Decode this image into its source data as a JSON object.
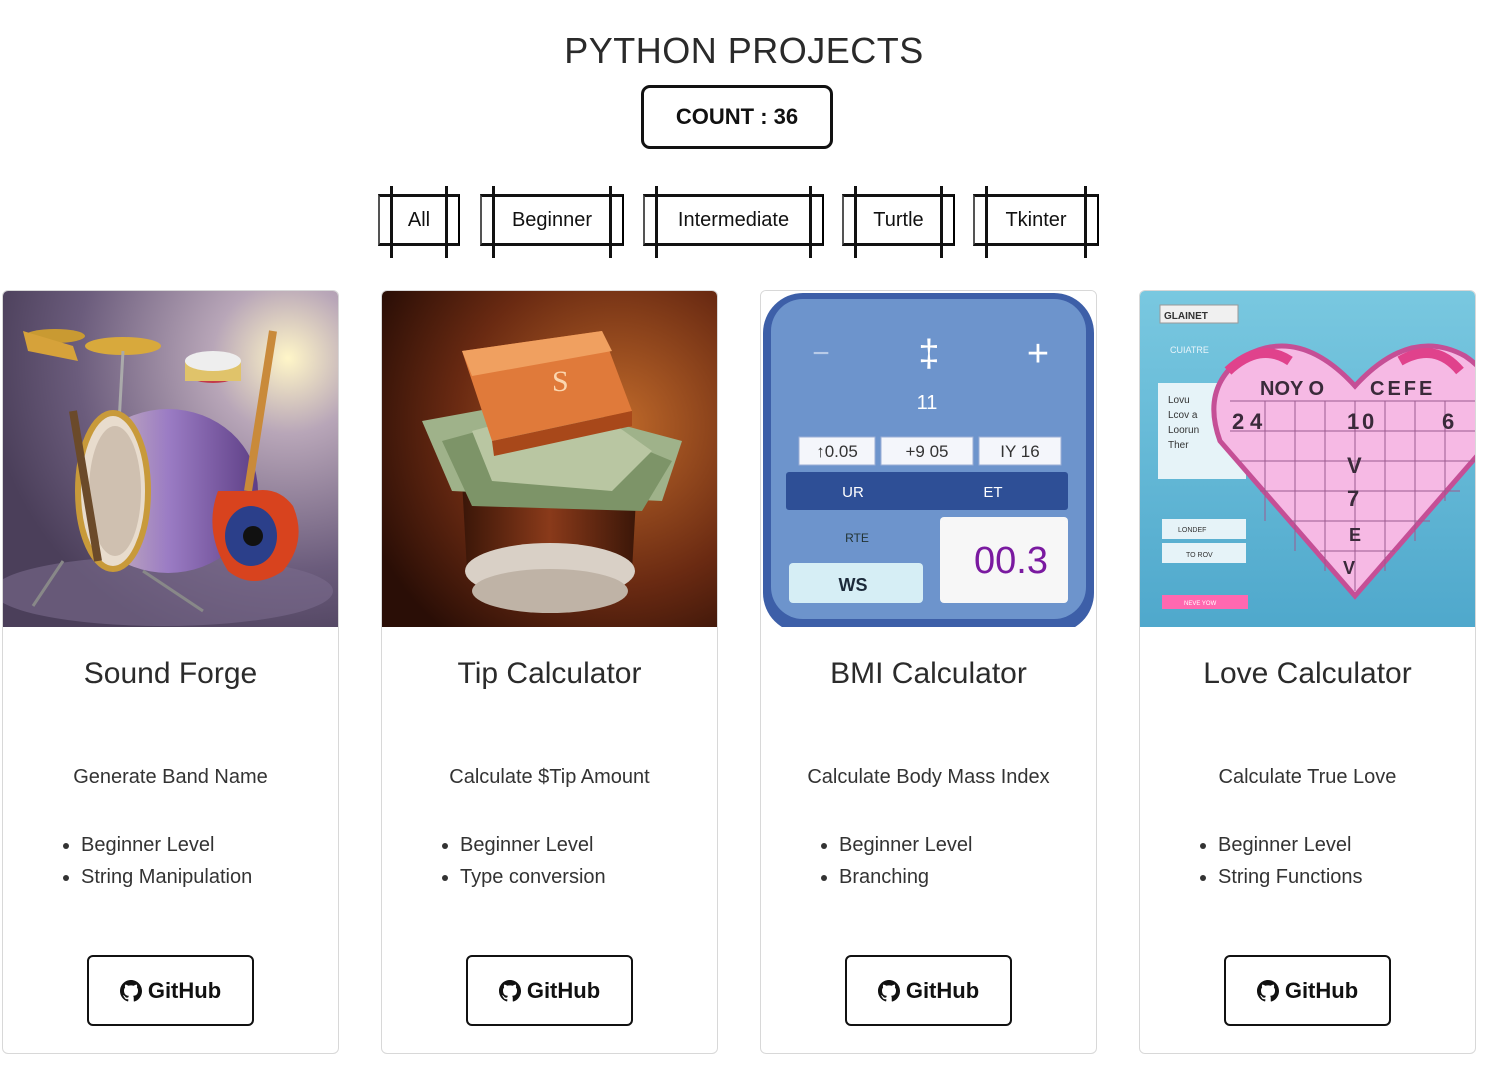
{
  "header": {
    "title": "PYTHON PROJECTS",
    "count": "COUNT : 36"
  },
  "filters": [
    "All",
    "Beginner",
    "Intermediate",
    "Turtle",
    "Tkinter"
  ],
  "cards": [
    {
      "title": "Sound Forge",
      "description": "Generate Band Name",
      "tags": [
        "Beginner Level",
        "String Manipulation"
      ],
      "button": "GitHub"
    },
    {
      "title": "Tip Calculator",
      "description": "Calculate $Tip Amount",
      "tags": [
        "Beginner Level",
        "Type conversion"
      ],
      "button": "GitHub"
    },
    {
      "title": "BMI Calculator",
      "description": "Calculate Body Mass Index",
      "tags": [
        "Beginner Level",
        "Branching"
      ],
      "button": "GitHub"
    },
    {
      "title": "Love Calculator",
      "description": "Calculate True Love",
      "tags": [
        "Beginner Level",
        "String Functions"
      ],
      "button": "GitHub"
    }
  ],
  "images": {
    "bmi": {
      "top_buttons": [
        "−",
        "‡",
        "+"
      ],
      "number": "11",
      "fields": [
        "↑0.05",
        "+9  05",
        "IY  16"
      ],
      "bar_left": "UR",
      "bar_right": "ET",
      "rate_label": "RTE",
      "ws_label": "WS",
      "display": "00.3"
    },
    "love": {
      "dropdown": "GLAINET",
      "subtitle": "CUIATRE",
      "side_text": [
        "Lovu",
        "Lcov a",
        "Loorun",
        "Ther"
      ],
      "heart_top": [
        "NOY O",
        "CEFE"
      ],
      "grid_nums": [
        "2",
        "4",
        "1",
        "0",
        "6"
      ],
      "grid_letters": [
        "V",
        "7",
        "E"
      ],
      "small_fields": [
        "LONDEF",
        "TO ROV"
      ],
      "pink_button": "NEVE YOW"
    }
  },
  "icons": {
    "github": "github-icon"
  }
}
